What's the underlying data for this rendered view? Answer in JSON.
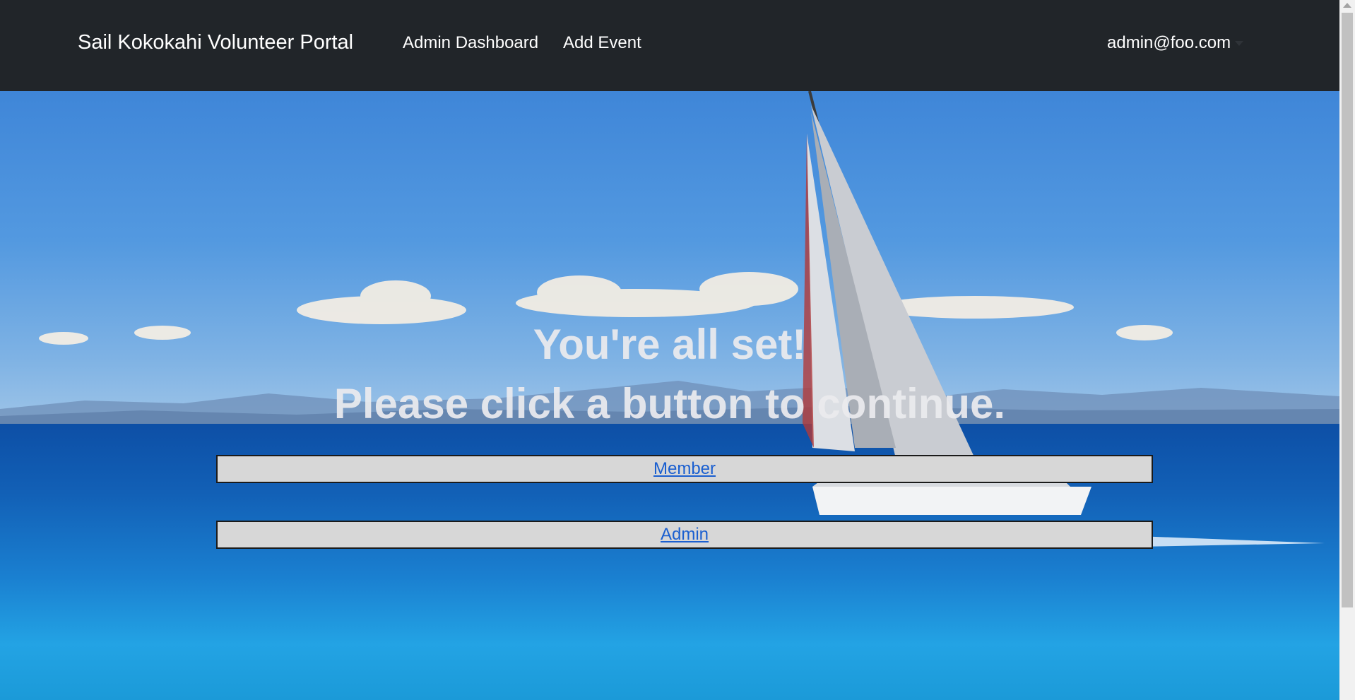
{
  "navbar": {
    "brand": "Sail Kokokahi Volunteer Portal",
    "links": [
      {
        "label": "Admin Dashboard"
      },
      {
        "label": "Add Event"
      }
    ],
    "user": "admin@foo.com"
  },
  "hero": {
    "headline": "You're all set!",
    "subheadline": "Please click a button to continue.",
    "buttons": [
      {
        "label": "Member"
      },
      {
        "label": "Admin"
      }
    ]
  },
  "colors": {
    "navbar_bg": "#212529",
    "button_bg": "#d7d7d7",
    "link": "#1a5fd0"
  }
}
